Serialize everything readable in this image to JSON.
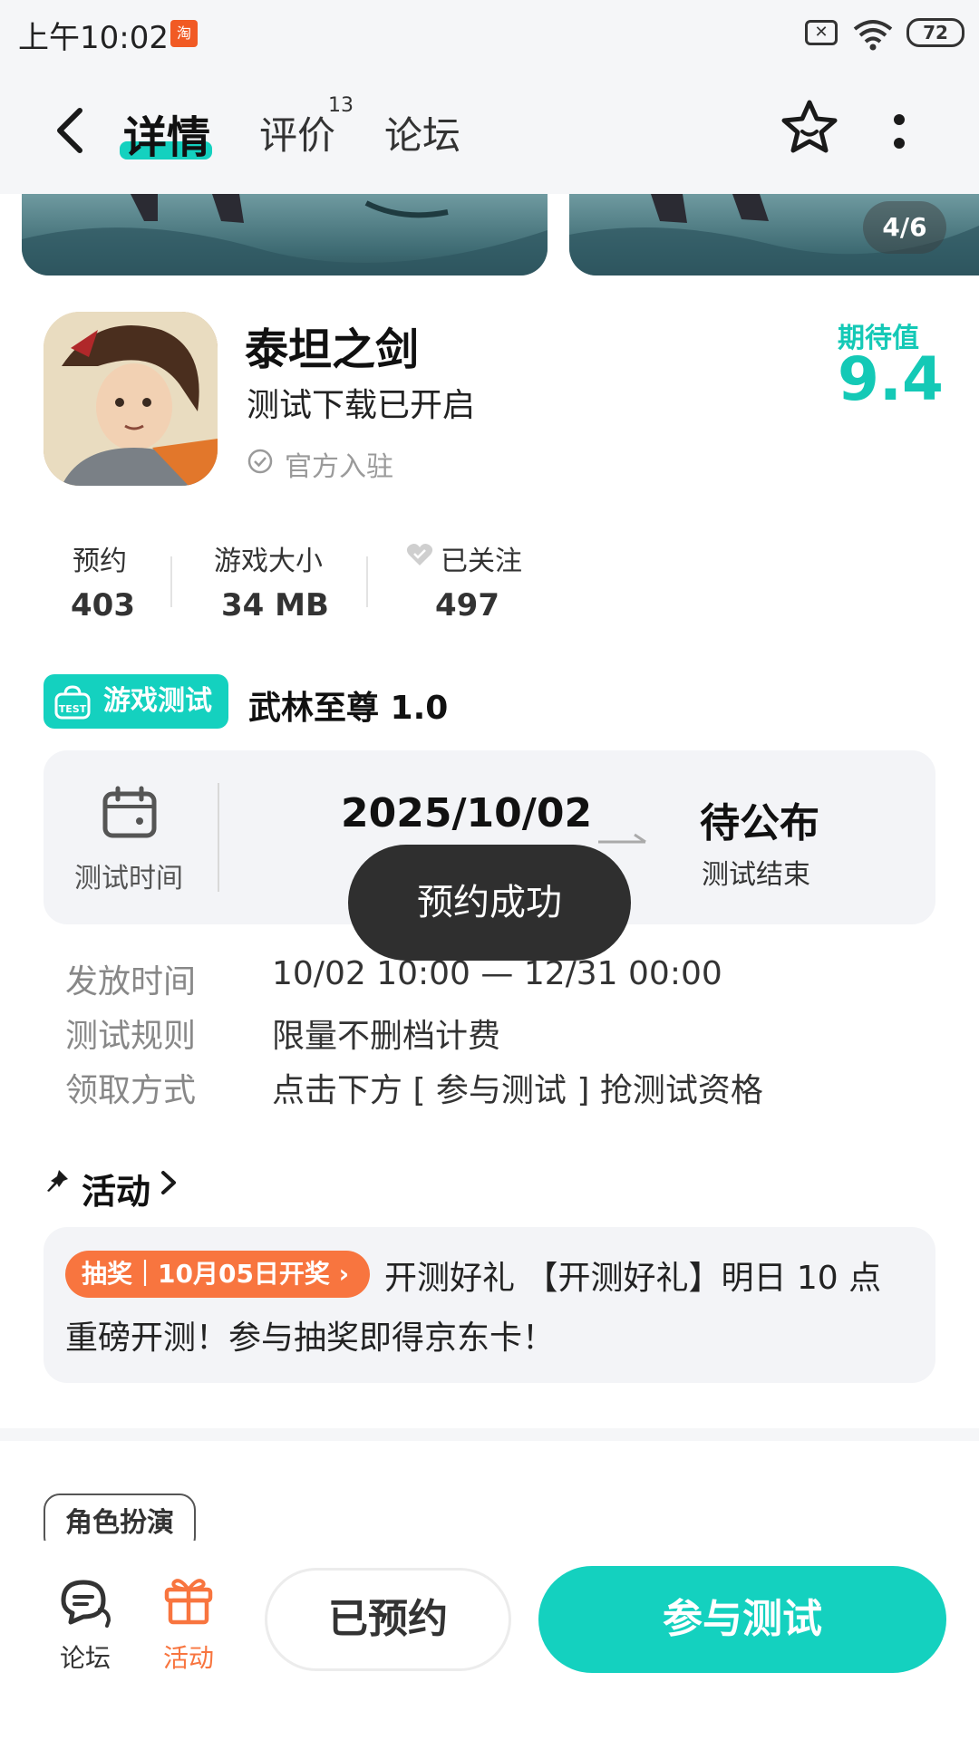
{
  "status_bar": {
    "time": "上午10:02",
    "taobao_icon": "淘",
    "sim_icon": "✕",
    "battery": "72"
  },
  "nav": {
    "tabs": [
      {
        "label": "详情"
      },
      {
        "label": "评价",
        "badge": "13"
      },
      {
        "label": "论坛"
      }
    ],
    "icons": [
      "back-icon",
      "favorite-star-icon",
      "more-vertical-icon"
    ]
  },
  "gallery": {
    "pager": "4/6"
  },
  "app": {
    "name": "泰坦之剑",
    "subtitle": "测试下载已开启",
    "official": "官方入驻",
    "expect_label": "期待值",
    "expect_value": "9.4"
  },
  "stats": [
    {
      "label": "预约",
      "value": "403"
    },
    {
      "label": "游戏大小",
      "value": "34 MB"
    },
    {
      "label": "已关注",
      "value": "497"
    }
  ],
  "test": {
    "badge": "游戏测试",
    "title": "武林至尊 1.0",
    "time_label": "测试时间",
    "start_date": "2025/10/02",
    "end_value": "待公布",
    "end_label": "测试结束",
    "toast": "预约成功",
    "info": [
      {
        "label": "发放时间",
        "value": "10/02 10:00 — 12/31 00:00"
      },
      {
        "label": "测试规则",
        "value": "限量不删档计费"
      },
      {
        "label": "领取方式",
        "value": "点击下方 [ 参与测试 ] 抢测试资格"
      }
    ]
  },
  "activity": {
    "title": "活动",
    "lottery_tag": "抽奖｜10月05日开奖 ›",
    "text": "开测好礼 【开测好礼】明日 10 点重磅开测！参与抽奖即得京东卡！"
  },
  "tag": "角色扮演",
  "bottom": {
    "forum_label": "论坛",
    "activity_label": "活动",
    "reserved_label": "已预约",
    "join_label": "参与测试"
  },
  "colors": {
    "accent": "#14d1bf",
    "orange": "#f8753f",
    "toast": "#2f2f2f"
  }
}
